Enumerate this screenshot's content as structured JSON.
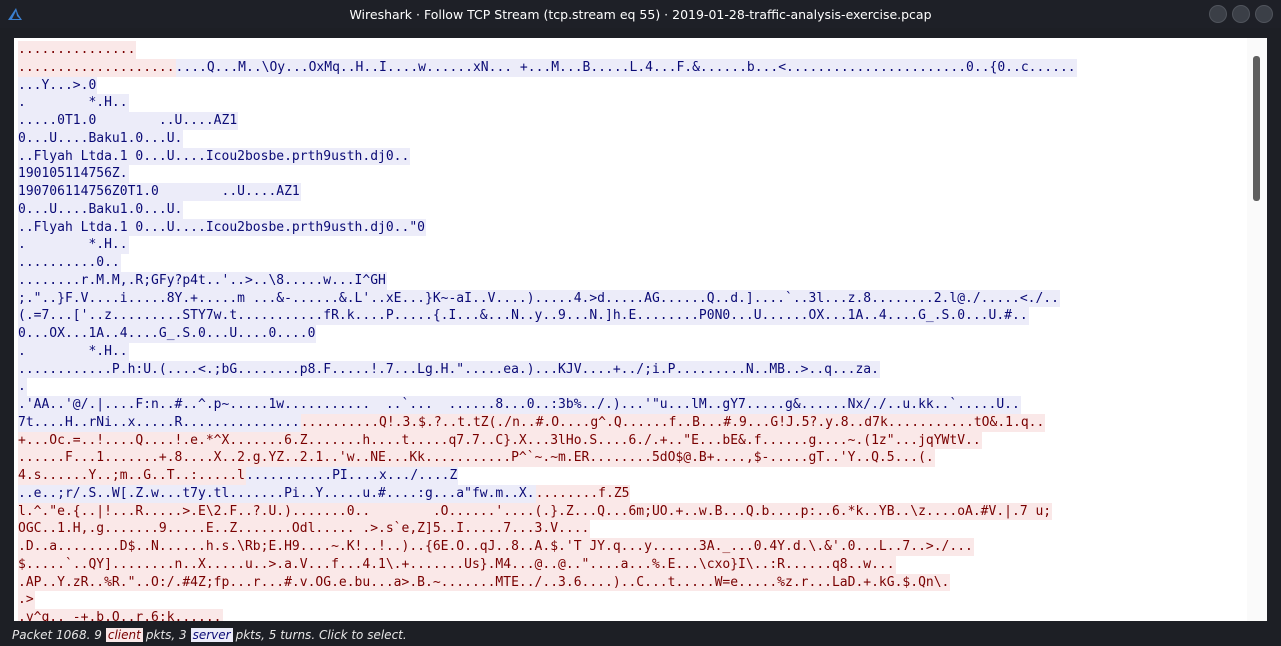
{
  "window": {
    "title": "Wireshark · Follow TCP Stream (tcp.stream eq 55) · 2019-01-28-traffic-analysis-exercise.pcap"
  },
  "icons": {
    "app": "wireshark-fin-icon",
    "buttons": [
      "minimize-icon",
      "maximize-icon",
      "close-icon"
    ]
  },
  "colors": {
    "client_bg": "#fae8e8",
    "client_fg": "#790000",
    "server_bg": "#ececf9",
    "server_fg": "#0a0a76"
  },
  "stream": {
    "lines": [
      [
        [
          "c",
          "..............."
        ]
      ],
      [
        [
          "c",
          "...................."
        ],
        [
          "s",
          "....Q...M..\\Oy...OxMq..H..I....w......xN... +...M...B.....L.4...F.&......b...<.......................0..{0..c......"
        ]
      ],
      [
        [
          "s",
          "...Y...>.0"
        ]
      ],
      [
        [
          "s",
          ".        *.H.."
        ]
      ],
      [
        [
          "s",
          ".....0T1.0        ..U....AZ1"
        ]
      ],
      [
        [
          "s",
          "0...U....Baku1.0...U."
        ]
      ],
      [
        [
          "s",
          "..Flyah Ltda.1 0...U....Icou2bosbe.prth9usth.dj0.."
        ]
      ],
      [
        [
          "s",
          "190105114756Z."
        ]
      ],
      [
        [
          "s",
          "190706114756Z0T1.0        ..U....AZ1"
        ]
      ],
      [
        [
          "s",
          "0...U....Baku1.0...U."
        ]
      ],
      [
        [
          "s",
          "..Flyah Ltda.1 0...U....Icou2bosbe.prth9usth.dj0..\"0"
        ]
      ],
      [
        [
          "s",
          ".        *.H.."
        ]
      ],
      [
        [
          "s",
          "..........0.."
        ]
      ],
      [
        [
          "s",
          "........r.M.M,.R;GFy?p4t..'..>..\\8.....w...I^GH"
        ]
      ],
      [
        [
          "s",
          ";.\"..}F.V....i.....8Y.+.....m ...&-......&.L'..xE...}K~-aI..V....).....4.>d.....AG......Q..d.]....`..3l...z.8........2.l@./.....<./.."
        ]
      ],
      [
        [
          "s",
          "(.=7...['..z.........STY7w.t...........fR.k....P.....{.I...&...N..y..9...N.]h.E........P0N0...U......OX...1A..4....G_.S.0...U.#.."
        ]
      ],
      [
        [
          "s",
          "0...OX...1A..4....G_.S.0...U....0....0"
        ]
      ],
      [
        [
          "s",
          ".        *.H.."
        ]
      ],
      [
        [
          "s",
          "............P.h:U.(....<.;bG........p8.F.....!.7...Lg.H.\".....ea.)...KJV....+../;i.P.........N..MB..>..q...za."
        ]
      ],
      [
        [
          "s",
          "."
        ]
      ],
      [
        [
          "s",
          ".'AA..'@/.|....F:n..#..^.p~.....1w...........  ..`...  ......8...0..:3b%../.)...'\"u...lM..gY7.....g&......Nx/./..u.kk..`.....U.."
        ]
      ],
      [
        [
          "s",
          "7t....H..rNi..x.....R..............."
        ],
        [
          "c",
          "..........Q!.3.$.?..t.tZ(./n..#.O....g^.Q......f..B...#.9...G!J.5?.y.8..d7k...........tO&.1.q.."
        ]
      ],
      [
        [
          "c",
          "+...Oc.=..!....Q....!.e.*^X.......6.Z.......h....t.....q7.7..C}.X...3lHo.S....6./.+..\"E...bE&.f......g....~.(1z\"...jqYWtV.."
        ]
      ],
      [
        [
          "c",
          "......F...1.......+.8....X..2.g.YZ..2.1..'w..NE...Kk...........P^`~.~m.ER........5dO$@.B+....,$-.....gT..'Y..Q.5...(."
        ]
      ],
      [
        [
          "c",
          "4.s......Y..;m..G..T..:.....l"
        ],
        [
          "s",
          "...........PI....x.../....Z"
        ]
      ],
      [
        [
          "s",
          "..e..;r/.S..W[.Z.w...t7y.tl.......Pi..Y.....u.#....:g...a\"fw.m..X."
        ],
        [
          "c",
          "........f.Z5"
        ]
      ],
      [
        [
          "c",
          "l.^.\"e.{..|!...R.....>.E\\2.F..?.U.).......0..        .O......'....(.}.Z...Q...6m;UO.+..w.B...Q.b....p:..6.*k..YB..\\z....oA.#V.|.7 u;"
        ]
      ],
      [
        [
          "c",
          "OGC..1.H,.g.......9.....E..Z.......Odl..... .>.s`e,Z]5..I.....7...3.V...."
        ]
      ],
      [
        [
          "c",
          ".D..a........D$..N......h.s.\\Rb;E.H9....~.K!..!..)..{6E.O..qJ..8..A.$.'T JY.q...y......3A._...0.4Y.d.\\.&'.0...L..7..>./..."
        ]
      ],
      [
        [
          "c",
          "$.....`..QY]........n..X.....u..>.a.V...f...4.1\\.+.......Us}.M4...@..@..\"....a...%.E...\\cxo}I\\..:R......q8..w..."
        ]
      ],
      [
        [
          "c",
          ".AP..Y.zR..%R.\"..O:/.#4Z;fp...r...#.v.OG.e.bu...a>.B.~.......MTE../..3.6....)..C...t.....W=e.....%z.r...LaD.+.kG.$.Qn\\."
        ]
      ],
      [
        [
          "c",
          ".>"
        ]
      ],
      [
        [
          "c",
          ".y^q.. -+.b.O..r.6;k......"
        ]
      ]
    ]
  },
  "status": {
    "prefix": "Packet 1068. 9",
    "client_label": "client",
    "middle": "pkts, 3",
    "server_label": "server",
    "suffix": "pkts, 5 turns. Click to select."
  }
}
